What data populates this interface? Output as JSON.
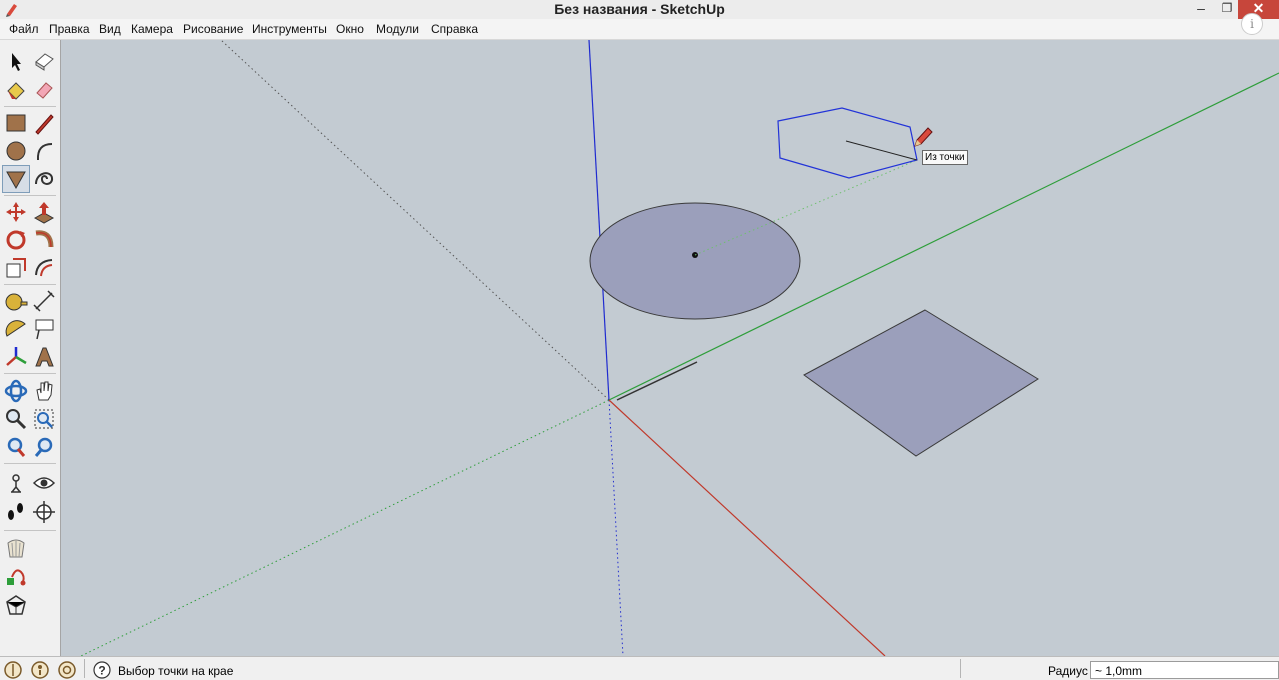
{
  "window": {
    "title": "Без названия - SketchUp",
    "minimize_glyph": "–",
    "restore_glyph": "❐",
    "close_glyph": "✕",
    "info_glyph": "i"
  },
  "menu": {
    "items": [
      "Файл",
      "Правка",
      "Вид",
      "Камера",
      "Рисование",
      "Инструменты",
      "Окно",
      "Модули",
      "Справка"
    ]
  },
  "toolbar": {
    "tools": [
      "select-icon",
      "make-component-icon",
      "paint-bucket-icon",
      "eraser-icon",
      "rectangle-icon",
      "line-icon",
      "circle-icon",
      "arc-icon",
      "polygon-icon",
      "freehand-icon",
      "move-icon",
      "push-pull-icon",
      "rotate-icon",
      "follow-me-icon",
      "scale-icon",
      "offset-icon",
      "tape-measure-icon",
      "dimension-icon",
      "protractor-icon",
      "text-icon",
      "axes-icon",
      "3d-text-icon",
      "orbit-icon",
      "pan-icon",
      "zoom-icon",
      "zoom-window-icon",
      "zoom-extents-icon",
      "previous-view-icon",
      "position-camera-icon",
      "look-around-icon",
      "walk-icon",
      "section-plane-icon",
      "warehouse-icon",
      "share-model-icon",
      "extension-warehouse-icon"
    ],
    "active_tool": "polygon-icon"
  },
  "viewport": {
    "background": "#c3cbd2",
    "axis_colors": {
      "x": "#c0392b",
      "y": "#2e9e3a",
      "z": "#1f2bd0"
    },
    "face_color": "#9b9fbb",
    "edge_color": "#3a3a3a",
    "tooltip": "Из точки"
  },
  "status": {
    "icons": [
      "geo-location-icon",
      "credits-icon",
      "sign-in-icon",
      "help-icon"
    ],
    "help_glyph": "?",
    "message": "Выбор точки на крае",
    "measurement_label": "Радиус",
    "measurement_value": "~ 1,0mm"
  }
}
